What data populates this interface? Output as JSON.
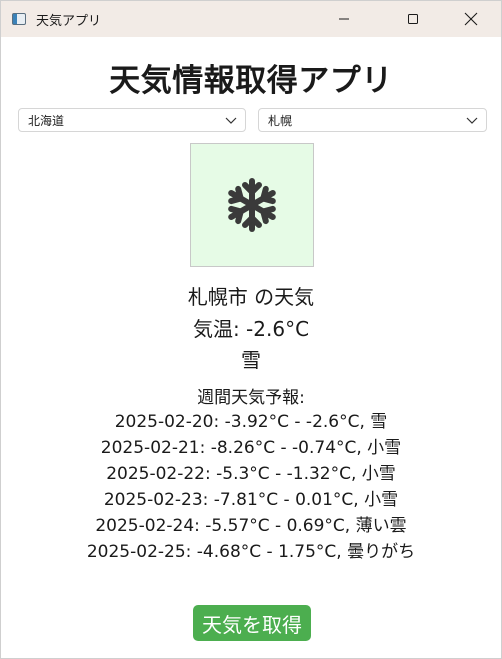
{
  "window": {
    "title": "天気アプリ"
  },
  "main": {
    "heading": "天気情報取得アプリ",
    "prefecture_select": {
      "selected": "北海道"
    },
    "city_select": {
      "selected": "札幌"
    },
    "weather_icon": "snowflake-icon",
    "city_title": "札幌市 の天気",
    "temperature": "気温: -2.6°C",
    "condition": "雪",
    "forecast_label": "週間天気予報:",
    "forecast": [
      "2025-02-20: -3.92°C - -2.6°C, 雪",
      "2025-02-21: -8.26°C - -0.74°C, 小雪",
      "2025-02-22: -5.3°C - -1.32°C, 小雪",
      "2025-02-23: -7.81°C - 0.01°C, 小雪",
      "2025-02-24: -5.57°C - 0.69°C, 薄い雲",
      "2025-02-25: -4.68°C - 1.75°C, 曇りがち"
    ],
    "get_button_label": "天気を取得"
  },
  "colors": {
    "titlebar_bg": "#f2ebe6",
    "icon_box_bg": "#e6fbe6",
    "button_bg": "#4cae4f",
    "icon_color": "#3a3a3a"
  }
}
